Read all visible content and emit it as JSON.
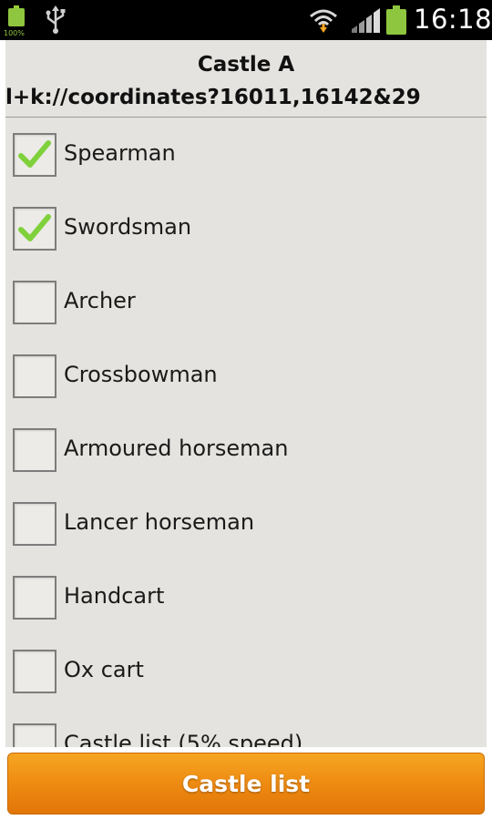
{
  "status_bar": {
    "battery_small_label": "100%",
    "time": "16:18"
  },
  "header": {
    "title": "Castle A",
    "subtitle": "l+k://coordinates?16011,16142&29"
  },
  "units": [
    {
      "label": "Spearman",
      "checked": true
    },
    {
      "label": "Swordsman",
      "checked": true
    },
    {
      "label": "Archer",
      "checked": false
    },
    {
      "label": "Crossbowman",
      "checked": false
    },
    {
      "label": "Armoured horseman",
      "checked": false
    },
    {
      "label": "Lancer horseman",
      "checked": false
    },
    {
      "label": "Handcart",
      "checked": false
    },
    {
      "label": "Ox cart",
      "checked": false
    },
    {
      "label": "Castle list (5% speed)",
      "checked": false
    }
  ],
  "footer": {
    "button_label": "Castle list"
  },
  "colors": {
    "accent": "#ed8810",
    "check": "#7fd13b",
    "panel_bg": "#e4e3df"
  }
}
